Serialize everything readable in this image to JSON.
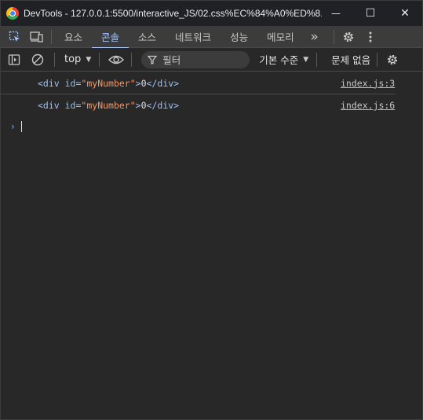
{
  "window": {
    "title": "DevTools - 127.0.0.1:5500/interactive_JS/02.css%EC%84%A0%ED%8...",
    "min_glyph": "—",
    "max_glyph": "☐",
    "close_glyph": "✕"
  },
  "tabs": [
    {
      "label": "요소"
    },
    {
      "label": "콘솔",
      "active": true
    },
    {
      "label": "소스"
    },
    {
      "label": "네트워크"
    },
    {
      "label": "성능"
    },
    {
      "label": "메모리"
    }
  ],
  "tab_more": "»",
  "toolbar": {
    "context": "top",
    "filter_placeholder": "필터",
    "levels": "기본 수준",
    "issues": "문제 없음"
  },
  "console": {
    "messages": [
      {
        "open": "<div ",
        "attr": "id",
        "eq": "=",
        "value": "\"myNumber\"",
        "close": ">",
        "text": "0",
        "end": "</div>",
        "source": "index.js:3"
      },
      {
        "open": "<div ",
        "attr": "id",
        "eq": "=",
        "value": "\"myNumber\"",
        "close": ">",
        "text": "0",
        "end": "</div>",
        "source": "index.js:6"
      }
    ],
    "prompt": "›"
  },
  "colors": {
    "accent": "#a8c7fa",
    "background": "#282828",
    "titlebar": "#202124",
    "attr_value": "#f29766"
  }
}
